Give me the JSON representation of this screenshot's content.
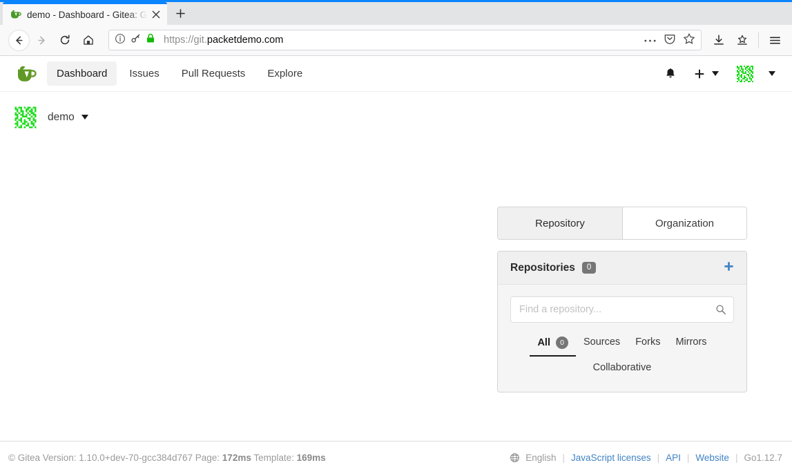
{
  "browser": {
    "tab": {
      "title": "demo - Dashboard - Gitea: G",
      "favicon_name": "gitea-favicon",
      "close_label": "✕"
    },
    "new_tab_label": "+",
    "nav": {
      "back_label": "←",
      "forward_label": "→",
      "reload_label": "↻",
      "home_label": "⌂"
    },
    "url": {
      "scheme": "https://git.",
      "host": "packetdemo.com",
      "info_icon": "page-info-icon",
      "permission_icon": "key-icon",
      "lock_icon": "lock-icon",
      "lock_color": "#12bc00"
    },
    "url_actions": {
      "page_actions": "…",
      "pocket_icon": "pocket-icon",
      "bookmark_icon": "star-icon"
    },
    "toolbar": {
      "downloads_icon": "download-icon",
      "save_to_pocket_icon": "library-icon",
      "menu_icon": "hamburger-menu-icon"
    }
  },
  "gitea": {
    "navbar": {
      "logo_name": "gitea-logo",
      "items": [
        {
          "label": "Dashboard",
          "active": true
        },
        {
          "label": "Issues",
          "active": false
        },
        {
          "label": "Pull Requests",
          "active": false
        },
        {
          "label": "Explore",
          "active": false
        }
      ],
      "notifications_icon": "bell-icon",
      "create_icon": "plus-icon",
      "avatar_name": "user-avatar-identicon"
    },
    "user": {
      "name": "demo",
      "avatar_name": "user-avatar-identicon"
    },
    "context_tabs": [
      {
        "label": "Repository",
        "active": true
      },
      {
        "label": "Organization",
        "active": false
      }
    ],
    "repositories_panel": {
      "title": "Repositories",
      "count": "0",
      "add_icon": "plus-icon",
      "add_color": "#4183c4",
      "search": {
        "value": "",
        "placeholder": "Find a repository...",
        "icon": "search-icon"
      },
      "filters": [
        {
          "label": "All",
          "badge": "0",
          "active": true
        },
        {
          "label": "Sources",
          "badge": null,
          "active": false
        },
        {
          "label": "Forks",
          "badge": null,
          "active": false
        },
        {
          "label": "Mirrors",
          "badge": null,
          "active": false
        }
      ],
      "filters_row2": [
        {
          "label": "Collaborative",
          "badge": null,
          "active": false
        }
      ]
    },
    "footer": {
      "copyright": "© Gitea Version: 1.10.0+dev-70-gcc384d767 Page:",
      "page_time": "172ms",
      "template_label": "Template:",
      "template_time": "169ms",
      "language_icon": "globe-icon",
      "language": "English",
      "links": [
        {
          "label": "JavaScript licenses",
          "type": "link"
        },
        {
          "label": "API",
          "type": "link"
        },
        {
          "label": "Website",
          "type": "link"
        },
        {
          "label": "Go1.12.7",
          "type": "muted"
        }
      ],
      "separator": "|"
    }
  }
}
